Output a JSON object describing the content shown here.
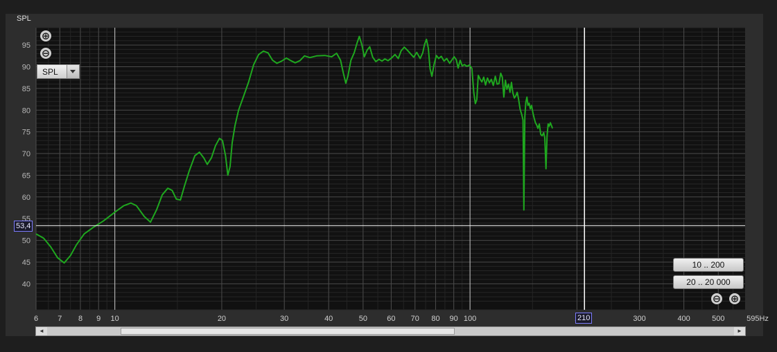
{
  "chart_data": {
    "type": "line",
    "y_axis_title": "SPL",
    "x_unit": "Hz",
    "x_scale": "log",
    "xlim": [
      6,
      595
    ],
    "ylim": [
      34,
      99
    ],
    "x_ticks": [
      {
        "v": 6,
        "label": "6"
      },
      {
        "v": 7,
        "label": "7"
      },
      {
        "v": 8,
        "label": "8"
      },
      {
        "v": 9,
        "label": "9"
      },
      {
        "v": 10,
        "label": "10"
      },
      {
        "v": 20,
        "label": "20"
      },
      {
        "v": 30,
        "label": "30"
      },
      {
        "v": 40,
        "label": "40"
      },
      {
        "v": 50,
        "label": "50"
      },
      {
        "v": 60,
        "label": "60"
      },
      {
        "v": 70,
        "label": "70"
      },
      {
        "v": 80,
        "label": "80"
      },
      {
        "v": 90,
        "label": "90"
      },
      {
        "v": 100,
        "label": "100"
      },
      {
        "v": 200,
        "label": "2"
      },
      {
        "v": 300,
        "label": "300"
      },
      {
        "v": 400,
        "label": "400"
      },
      {
        "v": 500,
        "label": "500"
      }
    ],
    "x_end_label": "595Hz",
    "y_ticks": [
      40,
      45,
      50,
      55,
      60,
      65,
      70,
      75,
      80,
      85,
      90,
      95
    ],
    "grid": true,
    "cursor_x": {
      "value": 210,
      "label": "210"
    },
    "cursor_y": {
      "value": 53.4,
      "label": "53,4"
    },
    "series": [
      {
        "color": "#1fa81f",
        "points": [
          [
            6,
            51.5
          ],
          [
            6.3,
            50.5
          ],
          [
            6.6,
            48.5
          ],
          [
            6.9,
            46
          ],
          [
            7.2,
            44.8
          ],
          [
            7.5,
            46.5
          ],
          [
            7.8,
            49
          ],
          [
            8.2,
            51.5
          ],
          [
            8.7,
            53
          ],
          [
            9.3,
            54.5
          ],
          [
            10,
            56.5
          ],
          [
            10.6,
            58
          ],
          [
            11.1,
            58.6
          ],
          [
            11.5,
            58
          ],
          [
            12.1,
            55.5
          ],
          [
            12.6,
            54.2
          ],
          [
            13.1,
            57
          ],
          [
            13.6,
            60.5
          ],
          [
            14.1,
            62
          ],
          [
            14.5,
            61.5
          ],
          [
            14.9,
            59.5
          ],
          [
            15.3,
            59.3
          ],
          [
            15.7,
            62.5
          ],
          [
            16.2,
            66
          ],
          [
            16.8,
            69.5
          ],
          [
            17.3,
            70.3
          ],
          [
            17.8,
            69
          ],
          [
            18.2,
            67.5
          ],
          [
            18.7,
            69
          ],
          [
            19.2,
            71.8
          ],
          [
            19.7,
            73.5
          ],
          [
            20.1,
            73
          ],
          [
            20.5,
            69.5
          ],
          [
            20.8,
            65
          ],
          [
            21.1,
            67
          ],
          [
            21.4,
            72.5
          ],
          [
            21.8,
            76.5
          ],
          [
            22.3,
            80
          ],
          [
            23,
            83
          ],
          [
            23.8,
            86.5
          ],
          [
            24.6,
            90.5
          ],
          [
            25.4,
            92.8
          ],
          [
            26.2,
            93.6
          ],
          [
            27,
            93.2
          ],
          [
            27.8,
            91.5
          ],
          [
            28.6,
            90.8
          ],
          [
            29.5,
            91.3
          ],
          [
            30.4,
            92
          ],
          [
            31.3,
            91.4
          ],
          [
            32.2,
            90.9
          ],
          [
            33.2,
            91.4
          ],
          [
            34.2,
            92.5
          ],
          [
            35.4,
            92.1
          ],
          [
            37,
            92.5
          ],
          [
            39,
            92.6
          ],
          [
            40.8,
            92.3
          ],
          [
            42.1,
            93.1
          ],
          [
            43.2,
            91.5
          ],
          [
            44,
            88.5
          ],
          [
            44.7,
            86.2
          ],
          [
            45.3,
            87.8
          ],
          [
            46.2,
            91.5
          ],
          [
            47.2,
            93.2
          ],
          [
            48.1,
            95.5
          ],
          [
            48.8,
            97
          ],
          [
            49.6,
            95
          ],
          [
            50.4,
            92.3
          ],
          [
            51.3,
            93.8
          ],
          [
            52.2,
            94.6
          ],
          [
            53.2,
            92.2
          ],
          [
            54.3,
            91.2
          ],
          [
            55.4,
            91.7
          ],
          [
            56.5,
            91.3
          ],
          [
            57.6,
            91.8
          ],
          [
            58.8,
            91.4
          ],
          [
            60.1,
            92
          ],
          [
            61.5,
            92.8
          ],
          [
            62.8,
            91.9
          ],
          [
            64,
            93.7
          ],
          [
            65.3,
            94.5
          ],
          [
            66.6,
            93.8
          ],
          [
            68,
            93
          ],
          [
            69.4,
            92.2
          ],
          [
            70.8,
            93.3
          ],
          [
            72.4,
            91.9
          ],
          [
            73.6,
            93.2
          ],
          [
            74.5,
            95.2
          ],
          [
            75.4,
            96.3
          ],
          [
            76.3,
            94.3
          ],
          [
            77.2,
            89.5
          ],
          [
            78.1,
            87.8
          ],
          [
            79.2,
            90.5
          ],
          [
            80.4,
            92.6
          ],
          [
            81.6,
            91.9
          ],
          [
            83,
            92.4
          ],
          [
            84.5,
            91.3
          ],
          [
            86,
            91.9
          ],
          [
            87.6,
            90.8
          ],
          [
            89,
            91.6
          ],
          [
            90.2,
            92.3
          ],
          [
            91.5,
            91.6
          ],
          [
            92.6,
            89.7
          ],
          [
            93.8,
            91.5
          ],
          [
            95,
            90.2
          ],
          [
            96.5,
            90.5
          ],
          [
            98,
            90.1
          ],
          [
            99.6,
            90.4
          ],
          [
            101.2,
            89.6
          ],
          [
            102.5,
            84
          ],
          [
            103.5,
            81.5
          ],
          [
            104.5,
            82.4
          ],
          [
            105.5,
            88
          ],
          [
            106.7,
            87.2
          ],
          [
            108,
            86.5
          ],
          [
            109.3,
            87.6
          ],
          [
            110.6,
            85.8
          ],
          [
            112,
            87.4
          ],
          [
            113.4,
            86.3
          ],
          [
            114.8,
            87.1
          ],
          [
            116.3,
            85.7
          ],
          [
            117.8,
            87.8
          ],
          [
            119.2,
            86
          ],
          [
            120.6,
            86.1
          ],
          [
            122,
            88.5
          ],
          [
            123.3,
            87.6
          ],
          [
            124.5,
            83
          ],
          [
            125.8,
            86.9
          ],
          [
            127,
            84.8
          ],
          [
            128.3,
            86
          ],
          [
            129.6,
            84.1
          ],
          [
            130.8,
            86.4
          ],
          [
            132,
            84
          ],
          [
            133.3,
            82.8
          ],
          [
            134.6,
            83.3
          ],
          [
            135.8,
            84.1
          ],
          [
            137,
            82.5
          ],
          [
            138.4,
            80.2
          ],
          [
            139.8,
            79
          ],
          [
            141,
            77.7
          ],
          [
            141.8,
            57
          ],
          [
            142.7,
            78.5
          ],
          [
            143.6,
            81.8
          ],
          [
            144.6,
            83
          ],
          [
            145.6,
            81.1
          ],
          [
            146.7,
            81.6
          ],
          [
            147.8,
            80.3
          ],
          [
            149,
            81.1
          ],
          [
            150.3,
            79.4
          ],
          [
            151.5,
            78.2
          ],
          [
            152.8,
            77.1
          ],
          [
            154,
            76.6
          ],
          [
            155.3,
            75.8
          ],
          [
            156.7,
            76.8
          ],
          [
            158.1,
            74.4
          ],
          [
            159.6,
            74.1
          ],
          [
            161.2,
            74.8
          ],
          [
            162.4,
            73.6
          ],
          [
            163.6,
            66.5
          ],
          [
            164.7,
            73.9
          ],
          [
            165.9,
            76.8
          ],
          [
            167.1,
            76.3
          ],
          [
            168.3,
            77.1
          ],
          [
            169.5,
            76.5
          ],
          [
            170.7,
            75.8
          ]
        ]
      }
    ]
  },
  "controls": {
    "select_value": "SPL",
    "range_buttons": [
      "10 .. 200",
      "20 .. 20 000"
    ],
    "zoom_in_glyph": "⊕",
    "zoom_out_glyph": "⊖"
  },
  "icons": {
    "zoom_in": "zoom-in-icon",
    "zoom_out": "zoom-out-icon",
    "scroll_left": "◄",
    "scroll_right": "►"
  }
}
